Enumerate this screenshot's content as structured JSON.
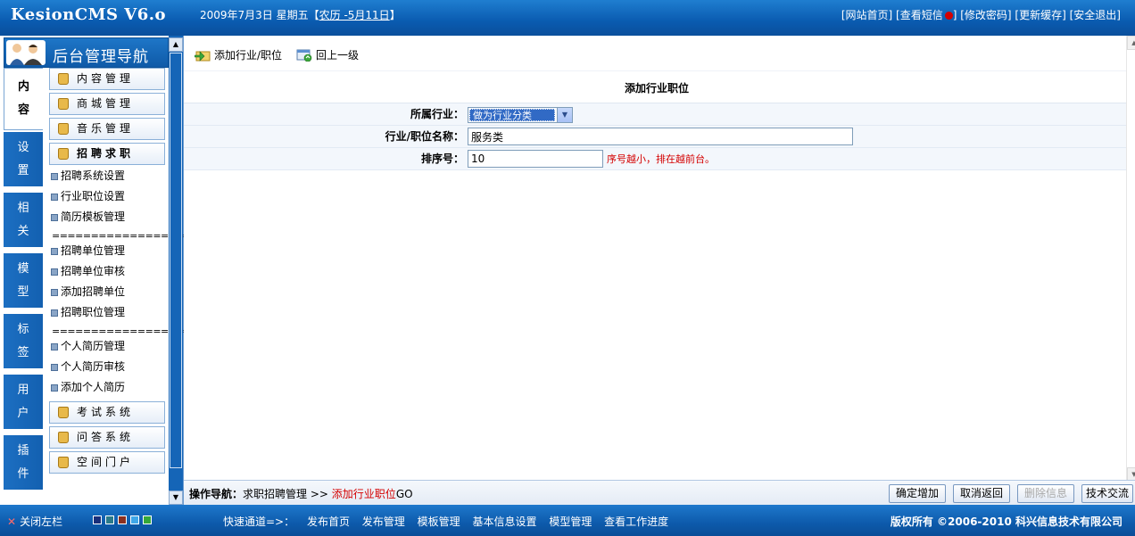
{
  "header": {
    "logo": "KesionCMS V6.o",
    "date": "2009年7月3日 星期五【",
    "lunar": "农历 -5月11日",
    "date_close": "】",
    "links": [
      "[网站首页]",
      "[查看短信",
      "]",
      "[修改密码]",
      "[更新缓存]",
      "[安全退出]"
    ]
  },
  "nav": {
    "title": "后台管理导航",
    "tabs": [
      {
        "c1": "内",
        "c2": "容"
      },
      {
        "c1": "设",
        "c2": "置"
      },
      {
        "c1": "相",
        "c2": "关"
      },
      {
        "c1": "模",
        "c2": "型"
      },
      {
        "c1": "标",
        "c2": "签"
      },
      {
        "c1": "用",
        "c2": "户"
      },
      {
        "c1": "插",
        "c2": "件"
      }
    ],
    "groups_top": [
      "内容管理",
      "商城管理",
      "音乐管理",
      "招聘求职"
    ],
    "items_a": [
      "招聘系统设置",
      "行业职位设置",
      "简历模板管理"
    ],
    "separator": "===================",
    "items_b": [
      "招聘单位管理",
      "招聘单位审核",
      "添加招聘单位",
      "招聘职位管理"
    ],
    "items_c": [
      "个人简历管理",
      "个人简历审核",
      "添加个人简历"
    ],
    "groups_bottom": [
      "考试系统",
      "问答系统",
      "空间门户"
    ]
  },
  "toolbar": {
    "add": "添加行业/职位",
    "back": "回上一级"
  },
  "form": {
    "title": "添加行业职位",
    "industry_label": "所属行业：",
    "industry_value": "做为行业分类",
    "name_label": "行业/职位名称：",
    "name_value": "服务类",
    "order_label": "排序号：",
    "order_value": "10",
    "order_hint": "序号越小，排在越前台。"
  },
  "status": {
    "label": "操作导航：",
    "path": "求职招聘管理",
    "sep": ">>",
    "current": "添加行业职位",
    "suffix": "GO",
    "buttons": [
      "确定增加",
      "取消返回",
      "删除信息",
      "技术交流"
    ]
  },
  "footer": {
    "close_left": "关闭左栏",
    "quick_label": "快速通道=>：",
    "quick_links": [
      "发布首页",
      "发布管理",
      "模板管理",
      "基本信息设置",
      "模型管理",
      "查看工作进度"
    ],
    "copyright": "版权所有 ©2006-2010 科兴信息技术有限公司",
    "swatch_colors": [
      "#1a2f7a",
      "#2a7a8a",
      "#8a3020",
      "#3fa7e8",
      "#36a83a"
    ]
  }
}
